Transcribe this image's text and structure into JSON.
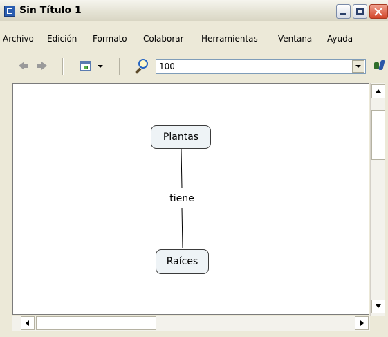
{
  "window": {
    "title": "Sin Título 1",
    "icon": "cmap-app-icon",
    "controls": [
      "minimize",
      "maximize",
      "close"
    ]
  },
  "menu": {
    "items": [
      {
        "label": "Archivo"
      },
      {
        "label": "Edición"
      },
      {
        "label": "Formato"
      },
      {
        "label": "Colaborar"
      },
      {
        "label": "Herramientas"
      },
      {
        "label": "Ventana"
      },
      {
        "label": "Ayuda"
      }
    ]
  },
  "toolbar": {
    "zoom_value": "100",
    "icons": [
      "back-arrow-icon",
      "forward-arrow-icon",
      "view-icon",
      "zoom-icon",
      "tools-icon"
    ]
  },
  "map": {
    "concepts": [
      {
        "label": "Plantas"
      },
      {
        "label": "Raíces"
      }
    ],
    "linking_phrase": "tiene"
  },
  "colors": {
    "window_background": "#ece9d8",
    "concept_fill": "#eef3f6",
    "close_button": "#d2462a"
  }
}
